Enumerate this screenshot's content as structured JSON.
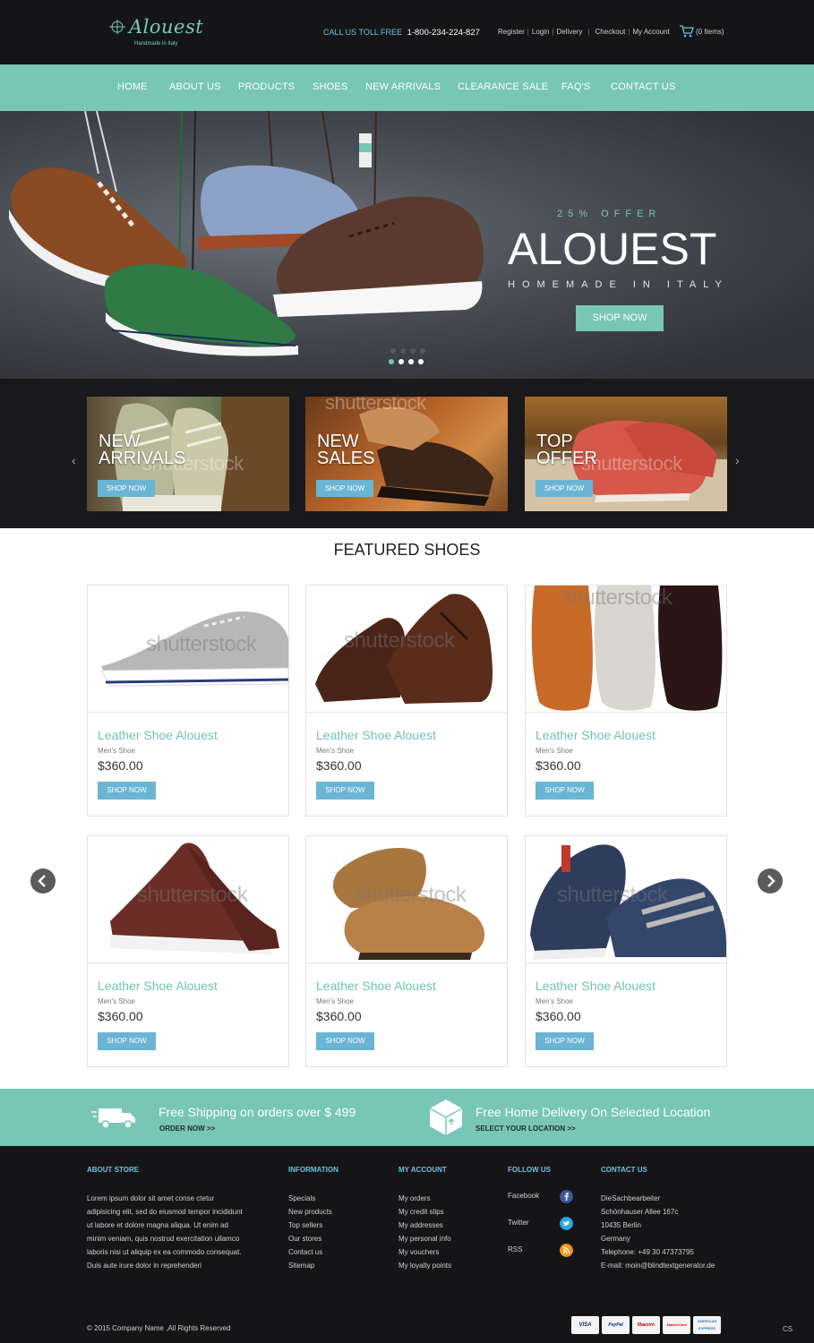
{
  "header": {
    "logo_text": "Alouest",
    "logo_tagline": "Handmade in Italy",
    "call_label": "CALL US TOLL FREE",
    "phone": "1-800-234-224-827",
    "links": [
      "Register",
      "Login",
      "Delivery",
      "Checkout",
      "My Account"
    ],
    "cart": "(0 Items)"
  },
  "nav": {
    "items": [
      "HOME",
      "ABOUT US",
      "PRODUCTS",
      "SHOES",
      "NEW ARRIVALS",
      "CLEARANCE SALE",
      "FAQ'S",
      "CONTACT US"
    ]
  },
  "hero": {
    "offer": "25% OFFER",
    "title": "ALOUEST",
    "subtitle": "HOMEMADE IN ITALY",
    "button": "SHOP NOW",
    "slides": 4,
    "active_slide": 1
  },
  "promos": [
    {
      "title": "NEW\nARRIVALS",
      "button": "SHOP NOW",
      "watermark": "shutterstock"
    },
    {
      "title": "NEW\nSALES",
      "button": "SHOP NOW",
      "watermark": "shutterstock"
    },
    {
      "title": "TOP\nOFFER",
      "button": "SHOP NOW",
      "watermark": "shutterstock"
    }
  ],
  "featured": {
    "title": "FEATURED SHOES",
    "products": [
      {
        "name": "Leather Shoe Alouest",
        "category": "Men's Shoe",
        "price": "$360.00",
        "button": "SHOP NOW",
        "watermark": "shutterstock"
      },
      {
        "name": "Leather Shoe Alouest",
        "category": "Men's Shoe",
        "price": "$360.00",
        "button": "SHOP NOW",
        "watermark": "shutterstock"
      },
      {
        "name": "Leather Shoe Alouest",
        "category": "Men's Shoe",
        "price": "$360.00",
        "button": "SHOP NOW",
        "watermark": "shutterstock"
      },
      {
        "name": "Leather Shoe Alouest",
        "category": "Men's Shoe",
        "price": "$360.00",
        "button": "SHOP NOW",
        "watermark": "shutterstock"
      },
      {
        "name": "Leather Shoe Alouest",
        "category": "Men's Shoe",
        "price": "$360.00",
        "button": "SHOP NOW",
        "watermark": "shutterstock"
      },
      {
        "name": "Leather Shoe Alouest",
        "category": "Men's Shoe",
        "price": "$360.00",
        "button": "SHOP NOW",
        "watermark": "shutterstock"
      }
    ]
  },
  "shipping": {
    "free_shipping": "Free Shipping on orders over $ 499",
    "order_now": "ORDER NOW >>",
    "home_delivery": "Free Home Delivery On Selected Location",
    "select_location": "SELECT YOUR LOCATION >>"
  },
  "footer": {
    "about_heading": "ABOUT STORE",
    "about_text": "Lorem ipsum dolor sit amet conse ctetur adipisicing elit, sed do eiusmod tempor incididunt ut labore et dolore magna aliqua. Ut enim ad minim veniam, quis nostrud exercitation ullamco laboris nisi ut aliquip ex ea commodo consequat. Duis aute irure dolor in reprehenderi",
    "info_heading": "INFORMATION",
    "info_links": [
      "Specials",
      "New products",
      "Top sellers",
      "Our stores",
      "Contact us",
      "Sitemap"
    ],
    "account_heading": "MY ACCOUNT",
    "account_links": [
      "My orders",
      "My credit slips",
      "My addresses",
      "My personal info",
      "My vouchers",
      "My loyalty points"
    ],
    "follow_heading": "FOLLOW US",
    "follow": [
      {
        "label": "Facebook",
        "icon": "facebook-icon",
        "color": "#3b5998"
      },
      {
        "label": "Twitter",
        "icon": "twitter-icon",
        "color": "#29a9e1"
      },
      {
        "label": "RSS",
        "icon": "rss-icon",
        "color": "#f7941d"
      }
    ],
    "contact_heading": "CONTACT US",
    "contact_lines": [
      "DieSachbearbeiter",
      "Schönhauser Allee 167c",
      "10435 Berlin",
      "Germany",
      "Telephone: +49 30 47373795",
      "E-mail: moin@blindtextgenerator.de"
    ],
    "copyright": "© 2015 Company Name ,All Rights Reserved",
    "payments": [
      "VISA",
      "PayPal",
      "Maestro",
      "MasterCard",
      "AMERICAN EXPRESS"
    ],
    "corner": "CS"
  },
  "colors": {
    "accent": "#77c6b8",
    "button": "#6ab5d3",
    "dark": "#151517"
  }
}
